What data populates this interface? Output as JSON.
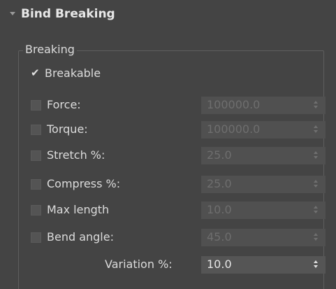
{
  "rollout": {
    "title": "Bind Breaking",
    "icon": "collapse-arrow-down"
  },
  "group": {
    "title": "Breaking"
  },
  "breakable": {
    "label": "Breakable",
    "checked": true
  },
  "params": [
    {
      "label": "Force:",
      "value": "100000.0",
      "checked": false,
      "enabled": false
    },
    {
      "label": "Torque:",
      "value": "100000.0",
      "checked": false,
      "enabled": false
    },
    {
      "label": "Stretch %:",
      "value": "25.0",
      "checked": false,
      "enabled": false
    },
    {
      "label": "Compress %:",
      "value": "25.0",
      "checked": false,
      "enabled": false
    },
    {
      "label": "Max length",
      "value": "10.0",
      "checked": false,
      "enabled": false
    },
    {
      "label": "Bend angle:",
      "value": "45.0",
      "checked": false,
      "enabled": false
    }
  ],
  "variation": {
    "label": "Variation %:",
    "value": "10.0",
    "enabled": true
  },
  "colors": {
    "background": "#444444",
    "text": "#dcdcdc",
    "disabled_text": "#6e6e6e"
  }
}
